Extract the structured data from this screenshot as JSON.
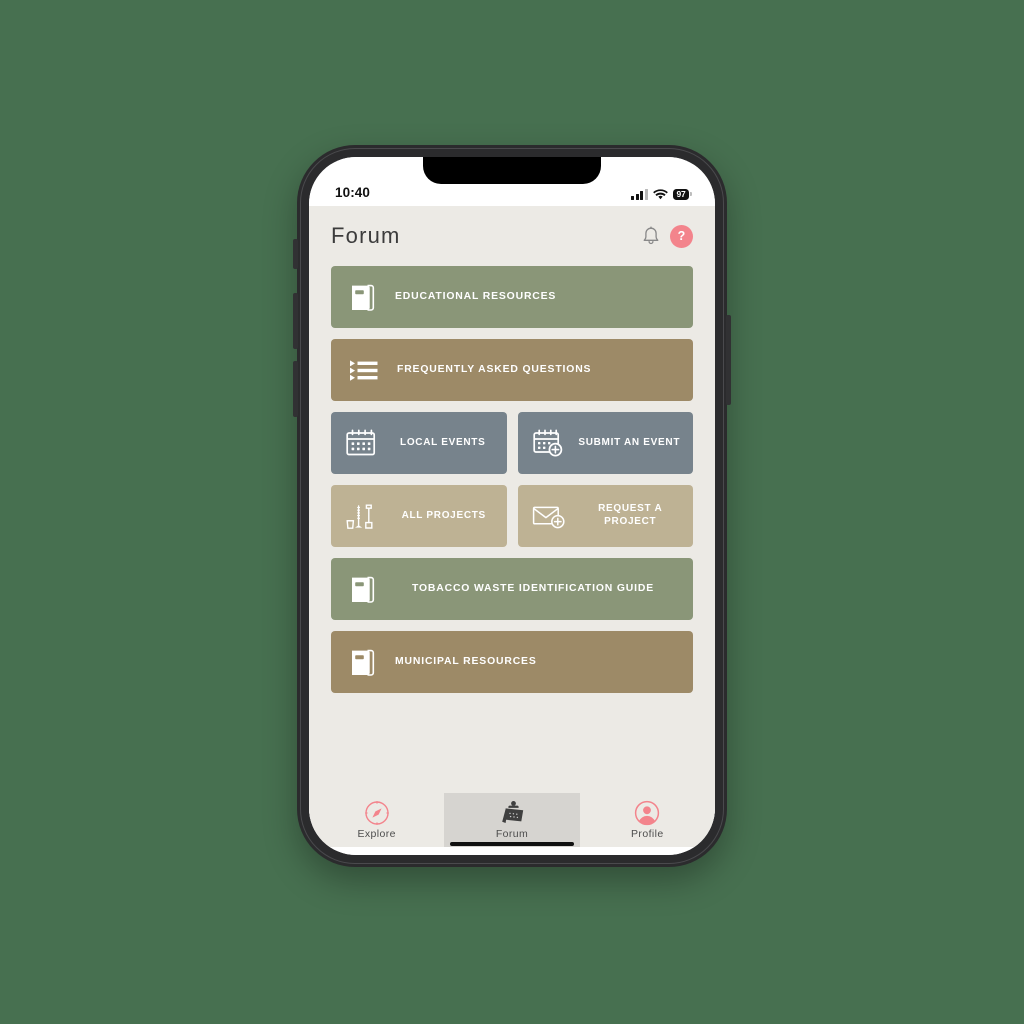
{
  "theme": {
    "page_background": "#477050",
    "app_background": "#eceae5",
    "accent_pink": "#f3848c",
    "green": "#8a9678",
    "brown": "#9d8a67",
    "blue_gray": "#77838c",
    "light_tan": "#beb294",
    "text_dark": "#3c3c3c"
  },
  "status_bar": {
    "time": "10:40",
    "battery_percent": "97",
    "signal_icon": "cellular-signal-icon",
    "wifi_icon": "wifi-icon",
    "battery_icon": "battery-icon"
  },
  "header": {
    "title": "Forum",
    "notifications_icon": "bell-icon",
    "help_label": "?"
  },
  "menu": {
    "tiles": [
      {
        "id": "educational-resources",
        "label": "EDUCATIONAL RESOURCES",
        "icon": "book-icon",
        "color": "#8a9678",
        "span": "wide"
      },
      {
        "id": "frequently-asked-questions",
        "label": "FREQUENTLY ASKED QUESTIONS",
        "icon": "bullet-list-icon",
        "color": "#9d8a67",
        "span": "wide"
      },
      {
        "id": "local-events",
        "label": "LOCAL EVENTS",
        "icon": "calendar-icon",
        "color": "#77838c",
        "span": "half"
      },
      {
        "id": "submit-an-event",
        "label": "SUBMIT AN EVENT",
        "icon": "calendar-plus-icon",
        "color": "#77838c",
        "span": "half"
      },
      {
        "id": "all-projects",
        "label": "ALL PROJECTS",
        "icon": "garden-tools-icon",
        "color": "#beb294",
        "span": "half"
      },
      {
        "id": "request-a-project",
        "label": "REQUEST A PROJECT",
        "icon": "envelope-plus-icon",
        "color": "#beb294",
        "span": "half"
      },
      {
        "id": "tobacco-waste-identification-guide",
        "label": "TOBACCO WASTE IDENTIFICATION GUIDE",
        "icon": "book-icon",
        "color": "#8a9678",
        "span": "wide"
      },
      {
        "id": "municipal-resources",
        "label": "MUNICIPAL RESOURCES",
        "icon": "book-icon",
        "color": "#9d8a67",
        "span": "wide"
      }
    ]
  },
  "tab_bar": {
    "tabs": [
      {
        "id": "explore",
        "label": "Explore",
        "icon": "compass-icon",
        "active": false
      },
      {
        "id": "forum",
        "label": "Forum",
        "icon": "clipboard-board-icon",
        "active": true
      },
      {
        "id": "profile",
        "label": "Profile",
        "icon": "user-avatar-icon",
        "active": false
      }
    ]
  }
}
